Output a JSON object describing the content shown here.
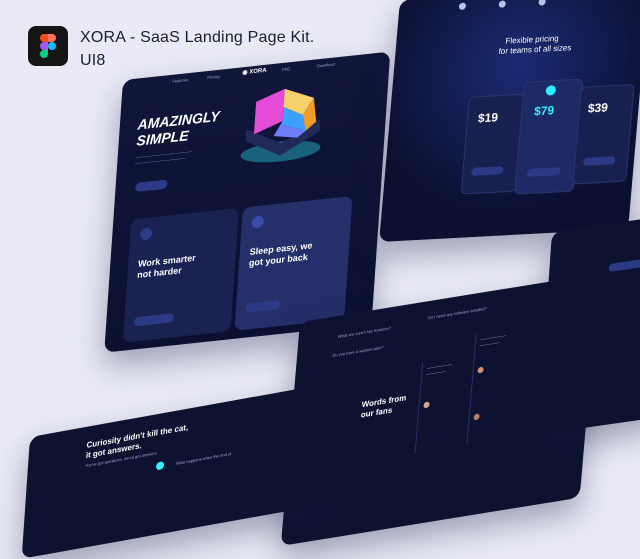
{
  "header": {
    "title_line1": "XORA - SaaS Landing Page Kit.",
    "title_line2": "UI8",
    "logo_icon": "figma-logo-icon"
  },
  "main_card": {
    "headline_line1": "AMAZINGLY",
    "headline_line2": "SIMPLE",
    "feature1_title_line1": "Work smarter",
    "feature1_title_line2": "not harder",
    "feature2_title_line1": "Sleep easy, we",
    "feature2_title_line2": "got your back"
  },
  "pricing_card": {
    "heading_line1": "Flexible pricing",
    "heading_line2": "for teams of all sizes",
    "price_1": "$19",
    "price_2": "$79",
    "price_3": "$39"
  },
  "faq_card": {
    "question_1": "What are xora's key features?",
    "question_2": "Do you have a support plan?",
    "question_3": "Do I need any software installed?",
    "testimonials_heading_line1": "Words from",
    "testimonials_heading_line2": "our fans"
  },
  "bottom_card": {
    "heading_line1": "Curiosity didn't kill the cat,",
    "heading_line2": "it got answers.",
    "subtext": "You've got questions, we've got answers.",
    "question": "What happens when the end of"
  },
  "colors": {
    "background": "#e9eaf5",
    "card": "#0d1230",
    "accent": "#2ef2ff"
  }
}
